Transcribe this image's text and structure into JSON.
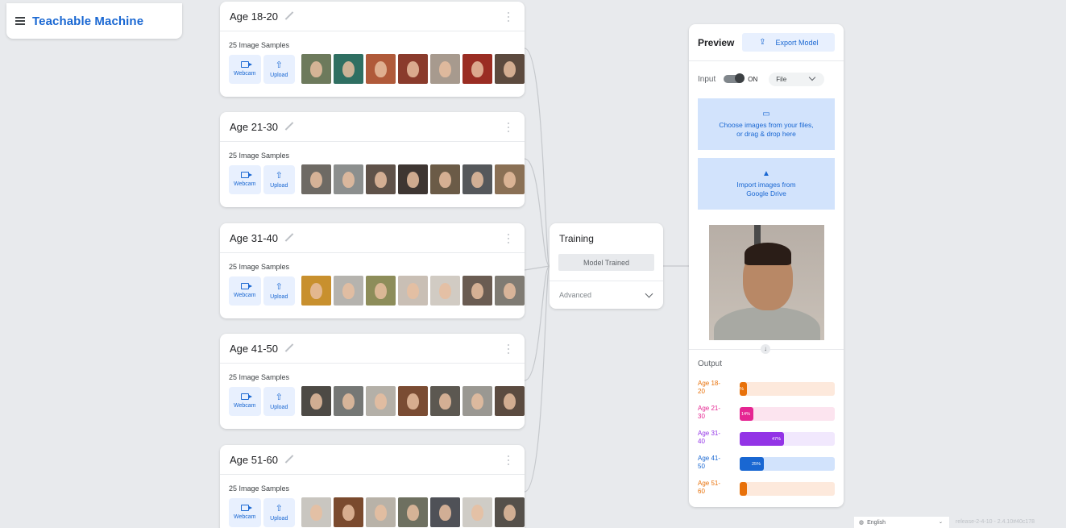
{
  "app": {
    "title": "Teachable Machine"
  },
  "classes": [
    {
      "name": "Age 18-20",
      "samples": "25 Image Samples",
      "webcam": "Webcam",
      "upload": "Upload"
    },
    {
      "name": "Age 21-30",
      "samples": "25 Image Samples",
      "webcam": "Webcam",
      "upload": "Upload"
    },
    {
      "name": "Age 31-40",
      "samples": "25 Image Samples",
      "webcam": "Webcam",
      "upload": "Upload"
    },
    {
      "name": "Age 41-50",
      "samples": "25 Image Samples",
      "webcam": "Webcam",
      "upload": "Upload"
    },
    {
      "name": "Age 51-60",
      "samples": "25 Image Samples",
      "webcam": "Webcam",
      "upload": "Upload"
    }
  ],
  "training": {
    "title": "Training",
    "button": "Model Trained",
    "advanced": "Advanced"
  },
  "preview": {
    "title": "Preview",
    "export": "Export Model",
    "input_label": "Input",
    "toggle_state": "ON",
    "source": "File",
    "drop_line1": "Choose images from your files,",
    "drop_line2": "or drag & drop here",
    "drive_line1": "Import images from",
    "drive_line2": "Google Drive",
    "output_title": "Output",
    "outputs": [
      {
        "label_line1": "Age 18-",
        "label_line2": "20",
        "percent": 3,
        "text": "%",
        "color": "#e8710a",
        "track": "#fde9dc"
      },
      {
        "label_line1": "Age 21-",
        "label_line2": "30",
        "percent": 14,
        "text": "14%",
        "color": "#e52592",
        "track": "#fce4ef"
      },
      {
        "label_line1": "Age 31-",
        "label_line2": "40",
        "percent": 47,
        "text": "47%",
        "color": "#9334e6",
        "track": "#f1e8fd"
      },
      {
        "label_line1": "Age 41-",
        "label_line2": "50",
        "percent": 25,
        "text": "25%",
        "color": "#1967d2",
        "track": "#d2e3fc"
      },
      {
        "label_line1": "Age 51-",
        "label_line2": "60",
        "percent": 3,
        "text": "",
        "color": "#e8710a",
        "track": "#fde9dc"
      }
    ]
  },
  "footer": {
    "language": "English",
    "release": "release-2-4-10 - 2.4.10#40c178"
  },
  "colors": {
    "accent": "#1967d2",
    "accent_light": "#e8f0fe",
    "background": "#e8eaed"
  }
}
